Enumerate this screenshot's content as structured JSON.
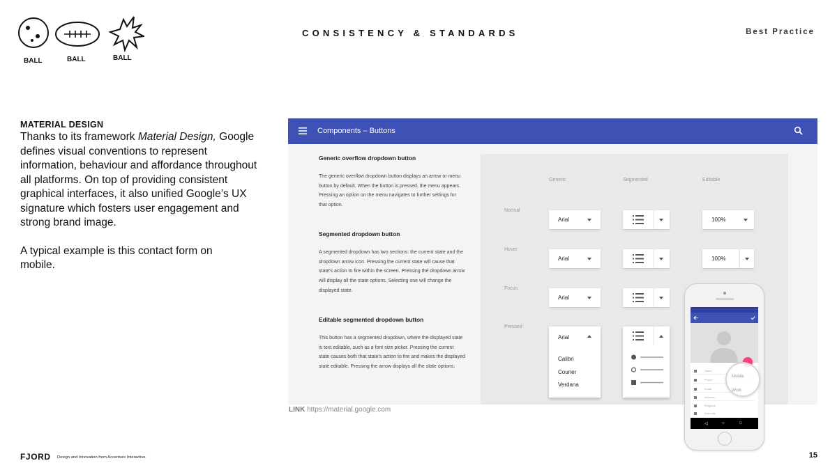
{
  "header": {
    "title": "CONSISTENCY & STANDARDS",
    "section": "Best Practice",
    "sketch_labels": [
      "BALL",
      "BALL",
      "BALL"
    ]
  },
  "left": {
    "heading": "MATERIAL DESIGN",
    "body_before_em": "Thanks to its framework ",
    "body_em": "Material Design,",
    "body_after_em": " Google defines visual conventions to represent information, behaviour and affordance throughout all platforms. On top of providing consistent graphical interfaces, it also unified Google’s UX signature which fosters user engagement and strong brand image.",
    "body2": "A typical example is this contact form on mobile."
  },
  "screenshot": {
    "appbar_title": "Components  –  Buttons",
    "sections": [
      {
        "heading": "Generic overflow dropdown button",
        "text": "The generic overflow dropdown button displays an arrow or menu button by default. When the button is pressed, the menu appears. Pressing an option on the menu navigates to further settings for that option."
      },
      {
        "heading": "Segmented dropdown button",
        "text": "A segmented dropdown has two sections: the current state and the dropdown arrow icon. Pressing the current state will cause that state's action to fire within the screen. Pressing the dropdown arrow will display all the state options. Selecting one will change the displayed state."
      },
      {
        "heading": "Editable segmented dropdown button",
        "text": "This button has a segmented dropdown, where the displayed state is text editable, such as a font size picker. Pressing the current state causes both that state's action to fire and makes the displayed state editable. Pressing the arrow displays all the state options."
      }
    ],
    "columns": [
      "Generic",
      "Segmented",
      "Editable"
    ],
    "rows": [
      "Normal",
      "Hover",
      "Focus",
      "Pressed"
    ],
    "generic_value": "Arial",
    "editable_value": "100%",
    "font_options": [
      "Calibri",
      "Courier",
      "Verdana"
    ]
  },
  "link": {
    "label": "LINK",
    "url": "https://material.google.com"
  },
  "phone": {
    "fields": [
      "Name",
      "Phone",
      "Email",
      "Address",
      "Ringtone",
      "Add note"
    ],
    "magnifier_options": [
      "Mobile",
      "Work"
    ]
  },
  "footer": {
    "brand": "FJORD",
    "tagline": "Design and Innovation from Accenture Interactive",
    "page": "15"
  },
  "colors": {
    "appbar": "#3f51b5",
    "fab": "#ff4081"
  }
}
